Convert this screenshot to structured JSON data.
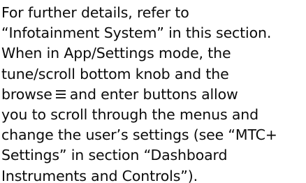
{
  "paragraph": {
    "lines": [
      "For further details, refer to",
      "“Infotainment System” in this section.",
      "When in App/Settings mode, the",
      "tune/scroll bottom knob and the",
      "browse",
      "and enter buttons allow",
      "you to scroll through the menus and",
      "change the user’s settings (see “MTC+",
      "Settings” in section “Dashboard",
      "Instruments and Controls”)."
    ]
  },
  "icons": {
    "browse": "menu-list-icon"
  }
}
